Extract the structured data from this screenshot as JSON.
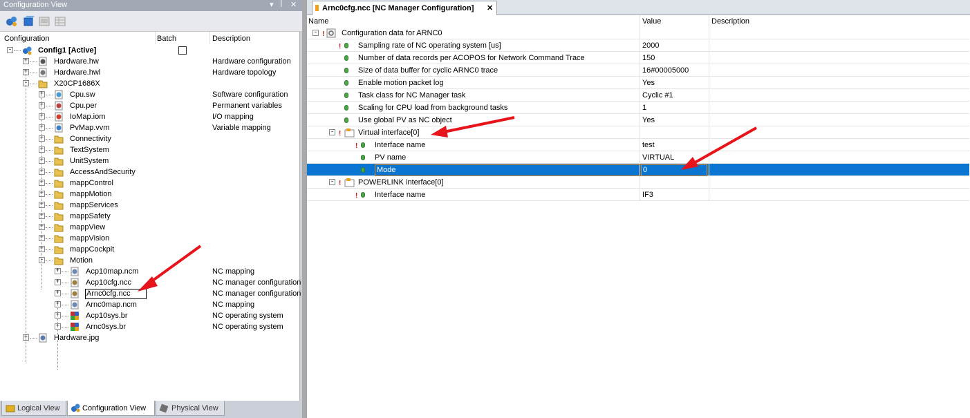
{
  "left_pane": {
    "title": "Configuration View",
    "title_buttons": [
      "▾",
      "ꟾ",
      "✕"
    ],
    "columns": {
      "configuration": "Configuration",
      "batch": "Batch",
      "description": "Description"
    },
    "tree": [
      {
        "label": "Config1 [Active]",
        "description": "",
        "icon": "config-icon"
      },
      {
        "label": "Hardware.hw",
        "description": "Hardware configuration",
        "icon": "hardware-icon"
      },
      {
        "label": "Hardware.hwl",
        "description": "Hardware topology",
        "icon": "topology-icon"
      },
      {
        "label": "X20CP1686X",
        "description": "",
        "icon": "folder-open-icon"
      },
      {
        "label": "Cpu.sw",
        "description": "Software configuration",
        "icon": "software-icon"
      },
      {
        "label": "Cpu.per",
        "description": "Permanent variables",
        "icon": "permanent-icon"
      },
      {
        "label": "IoMap.iom",
        "description": "I/O mapping",
        "icon": "io-map-icon"
      },
      {
        "label": "PvMap.vvm",
        "description": "Variable mapping",
        "icon": "variable-map-icon"
      },
      {
        "label": "Connectivity",
        "description": "",
        "icon": "folder-icon"
      },
      {
        "label": "TextSystem",
        "description": "",
        "icon": "text-folder-icon"
      },
      {
        "label": "UnitSystem",
        "description": "",
        "icon": "unit-folder-icon"
      },
      {
        "label": "AccessAndSecurity",
        "description": "",
        "icon": "security-folder-icon"
      },
      {
        "label": "mappControl",
        "description": "",
        "icon": "folder-icon"
      },
      {
        "label": "mappMotion",
        "description": "",
        "icon": "motion-folder-icon"
      },
      {
        "label": "mappServices",
        "description": "",
        "icon": "folder-icon"
      },
      {
        "label": "mappSafety",
        "description": "",
        "icon": "safety-folder-icon"
      },
      {
        "label": "mappView",
        "description": "",
        "icon": "view-folder-icon"
      },
      {
        "label": "mappVision",
        "description": "",
        "icon": "vision-folder-icon"
      },
      {
        "label": "mappCockpit",
        "description": "",
        "icon": "cockpit-folder-icon"
      },
      {
        "label": "Motion",
        "description": "",
        "icon": "folder-open-icon"
      },
      {
        "label": "Acp10map.ncm",
        "description": "NC mapping",
        "icon": "nc-mapping-icon"
      },
      {
        "label": "Acp10cfg.ncc",
        "description": "NC manager configuration",
        "icon": "nc-config-icon"
      },
      {
        "label": "Arnc0cfg.ncc",
        "description": "NC manager configuration",
        "icon": "nc-config-icon"
      },
      {
        "label": "Arnc0map.ncm",
        "description": "NC mapping",
        "icon": "nc-mapping-icon"
      },
      {
        "label": "Acp10sys.br",
        "description": "NC operating system",
        "icon": "nc-os-icon"
      },
      {
        "label": "Arnc0sys.br",
        "description": "NC operating system",
        "icon": "nc-os-icon"
      },
      {
        "label": "Hardware.jpg",
        "description": "",
        "icon": "image-icon"
      }
    ],
    "tabs": [
      "Logical View",
      "Configuration View",
      "Physical View"
    ]
  },
  "right_pane": {
    "doc_tab": "Arnc0cfg.ncc [NC Manager Configuration]",
    "doc_tab_close": "✕",
    "columns": {
      "name": "Name",
      "value": "Value",
      "description": "Description"
    },
    "rows": [
      {
        "name": "Configuration data for ARNC0",
        "value": ""
      },
      {
        "name": "Sampling rate of NC operating system [us]",
        "value": "2000"
      },
      {
        "name": "Number of data records per ACOPOS for Network Command Trace",
        "value": "150"
      },
      {
        "name": "Size of data buffer for cyclic ARNC0 trace",
        "value": "16#00005000"
      },
      {
        "name": "Enable motion packet log",
        "value": "Yes"
      },
      {
        "name": "Task class for NC Manager task",
        "value": "Cyclic #1"
      },
      {
        "name": "Scaling for CPU load from background tasks",
        "value": "1"
      },
      {
        "name": "Use global PV as NC object",
        "value": "Yes"
      },
      {
        "name": "Virtual interface[0]",
        "value": ""
      },
      {
        "name": "Interface name",
        "value": "test"
      },
      {
        "name": "PV name",
        "value": "VIRTUAL"
      },
      {
        "name": "Mode",
        "value": "0"
      },
      {
        "name": "POWERLINK interface[0]",
        "value": ""
      },
      {
        "name": "Interface name",
        "value": "IF3"
      }
    ]
  },
  "colors": {
    "selection": "#0a75d1",
    "annotation_arrow": "#e8141c"
  }
}
